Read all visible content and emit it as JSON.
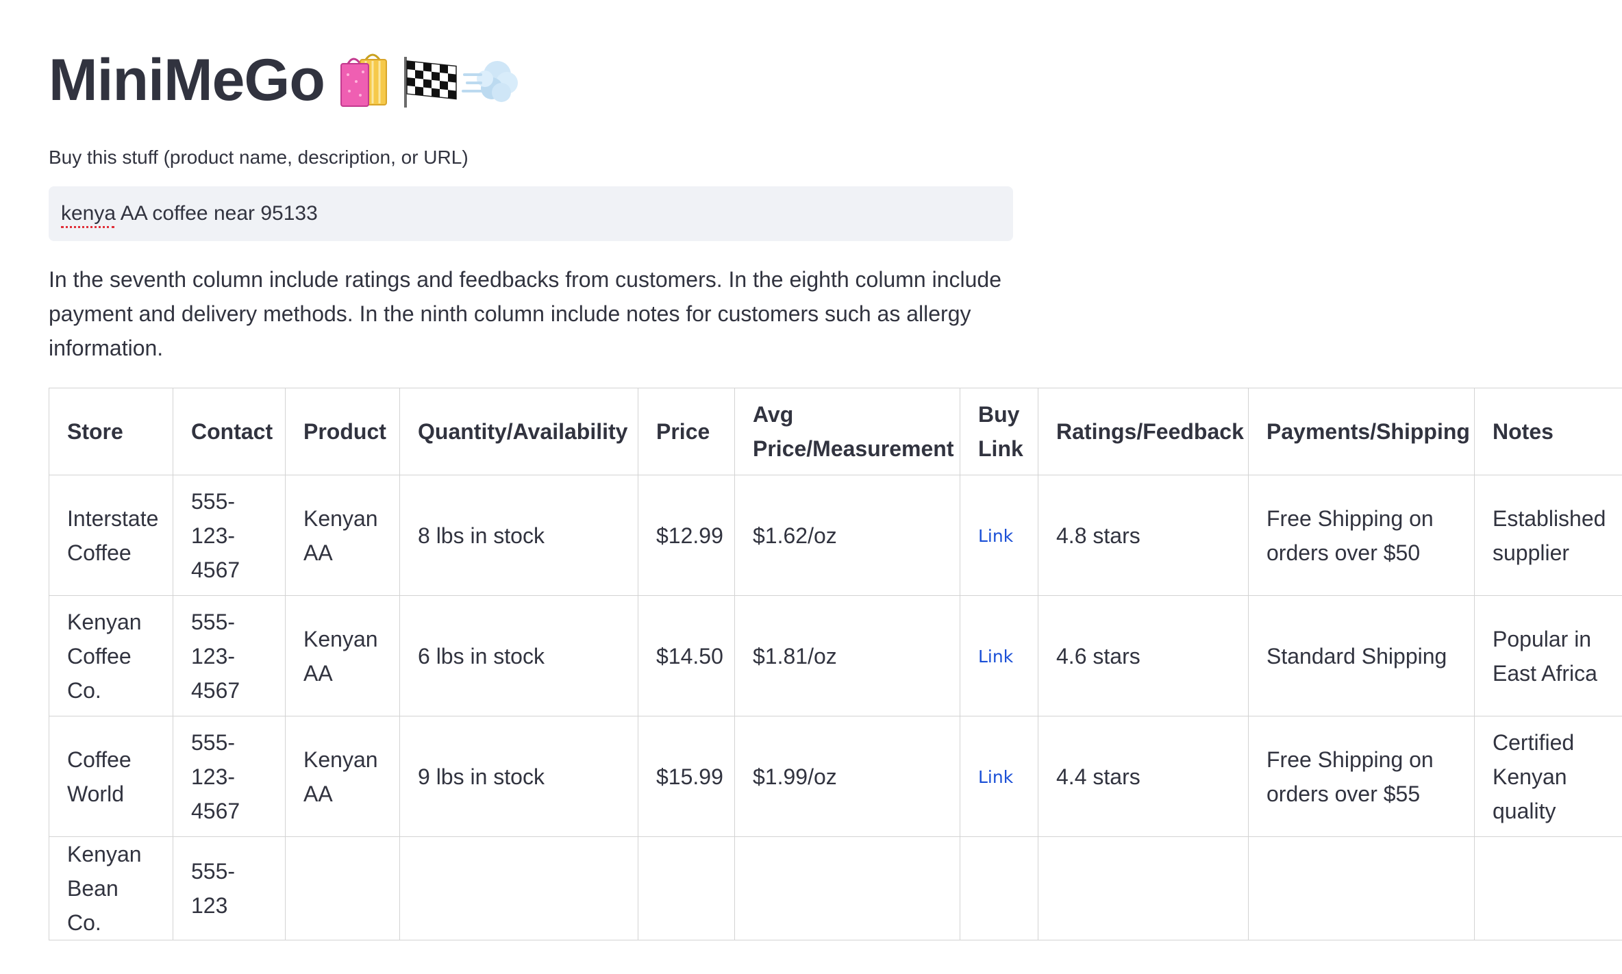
{
  "app": {
    "title": "MiniMeGo",
    "title_icons": [
      "shopping-bags-icon",
      "checkered-flag-icon",
      "wind-puff-icon"
    ]
  },
  "search": {
    "label": "Buy this stuff (product name, description, or URL)",
    "value": "kenya AA coffee near 95133"
  },
  "instructions": "In the seventh column include ratings and feedbacks from customers. In the eighth column include payment and delivery methods. In the ninth column include notes for customers such as allergy information.",
  "table": {
    "headers": [
      "Store",
      "Contact",
      "Product",
      "Quantity/Availability",
      "Price",
      "Avg Price/Measurement",
      "Buy Link",
      "Ratings/Feedback",
      "Payments/Shipping",
      "Notes"
    ],
    "rows": [
      [
        "Interstate Coffee",
        "555-123-4567",
        "Kenyan AA",
        "8 lbs in stock",
        "$12.99",
        "$1.62/oz",
        "Link",
        "4.8 stars",
        "Free Shipping on orders over $50",
        "Established supplier"
      ],
      [
        "Kenyan Coffee Co.",
        "555-123-4567",
        "Kenyan AA",
        "6 lbs in stock",
        "$14.50",
        "$1.81/oz",
        "Link",
        "4.6 stars",
        "Standard Shipping",
        "Popular in East Africa"
      ],
      [
        "Coffee World",
        "555-123-4567",
        "Kenyan AA",
        "9 lbs in stock",
        "$15.99",
        "$1.99/oz",
        "Link",
        "4.4 stars",
        "Free Shipping on orders over $55",
        "Certified Kenyan quality"
      ],
      [
        "Kenyan Bean Co.",
        "555-123",
        "",
        "",
        "",
        "",
        "",
        "",
        "",
        ""
      ]
    ]
  },
  "colors": {
    "text": "#31333f",
    "input_bg": "#f0f2f6",
    "link": "#1a4fd6",
    "border": "#d3d3d3"
  }
}
